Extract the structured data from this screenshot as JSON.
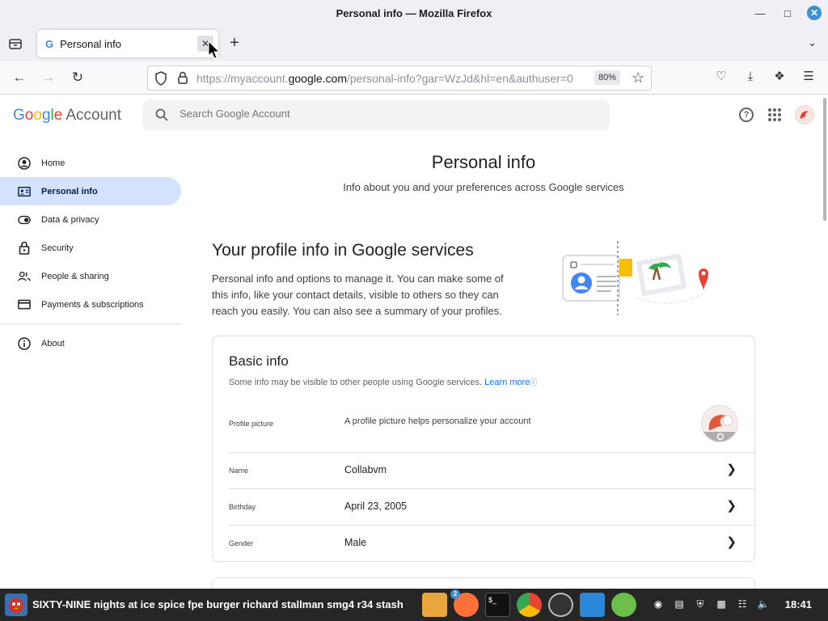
{
  "browser": {
    "window_title": "Personal info — Mozilla Firefox",
    "tab_label": "Personal info",
    "tab_favicon": "G",
    "url_prefix": "https://myaccount.",
    "url_domain": "google.com",
    "url_suffix": "/personal-info?gar=WzJd&hl=en&authuser=0",
    "zoom": "80%"
  },
  "header": {
    "logo_text": [
      "G",
      "o",
      "o",
      "g",
      "l",
      "e"
    ],
    "account_label": "Account",
    "search_placeholder": "Search Google Account",
    "help_glyph": "?"
  },
  "sidebar": {
    "items": [
      {
        "label": "Home",
        "icon": "person-circle-icon",
        "active": false
      },
      {
        "label": "Personal info",
        "icon": "id-card-icon",
        "active": true
      },
      {
        "label": "Data & privacy",
        "icon": "toggle-icon",
        "active": false
      },
      {
        "label": "Security",
        "icon": "lock-icon",
        "active": false
      },
      {
        "label": "People & sharing",
        "icon": "people-icon",
        "active": false
      },
      {
        "label": "Payments & subscriptions",
        "icon": "credit-card-icon",
        "active": false
      }
    ],
    "about": {
      "label": "About",
      "icon": "info-icon"
    }
  },
  "main": {
    "title": "Personal info",
    "subtitle": "Info about you and your preferences across Google services",
    "section_title": "Your profile info in Google services",
    "section_desc": "Personal info and options to manage it. You can make some of this info, like your contact details, visible to others so they can reach you easily. You can also see a summary of your profiles."
  },
  "basic_info": {
    "title": "Basic info",
    "note": "Some info may be visible to other people using Google services.",
    "learn_more": "Learn more",
    "profile_picture": {
      "label": "Profile picture",
      "value": "A profile picture helps personalize your account"
    },
    "rows": [
      {
        "label": "Name",
        "value": "Collabvm"
      },
      {
        "label": "Birthday",
        "value": "April 23, 2005"
      },
      {
        "label": "Gender",
        "value": "Male"
      }
    ]
  },
  "taskbar": {
    "active_window": "SIXTY-NINE nights at ice spice fpe burger richard stallman smg4 r34 stash",
    "firefox_badge": "2",
    "clock": "18:41"
  },
  "colors": {
    "accent": "#1a73e8",
    "active_nav": "#d3e3fd",
    "taskbar": "#262626"
  }
}
